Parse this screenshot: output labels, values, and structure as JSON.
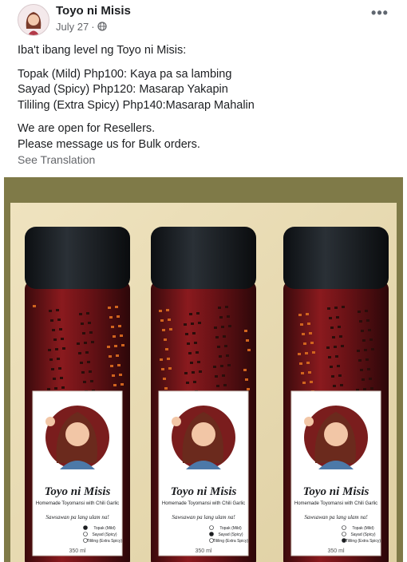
{
  "post": {
    "author": "Toyo ni Misis",
    "date": "July 27",
    "audience_icon": "globe-icon",
    "more_icon": "ellipsis-icon",
    "more_label": "•••",
    "lines": [
      "Iba't ibang level ng Toyo ni Misis:",
      "Topak (Mild) Php100: Kaya pa sa lambing",
      "Sayad (Spicy) Php120: Masarap Yakapin",
      "Tililing (Extra Spicy) Php140:Masarap Mahalin",
      "We are open for Resellers.",
      "Please message us for Bulk orders."
    ],
    "see_translation": "See Translation"
  },
  "photo": {
    "label": {
      "brand": "Toyo ni Misis",
      "subtitle": "Homemade Toyomansi with Chili Garlic",
      "tagline": "Sawsawan pa lang ulam na!",
      "options": [
        "Topak (Mild)",
        "Sayad (Spicy)",
        "Tililing (Extra Spicy)"
      ],
      "volume": "350 ml"
    }
  },
  "colors": {
    "frame": "#7f7a48",
    "wall": "#e8dcb4",
    "cap": "#161a1f",
    "sauce": "#6e1518",
    "label_red": "#7a1d1d"
  }
}
